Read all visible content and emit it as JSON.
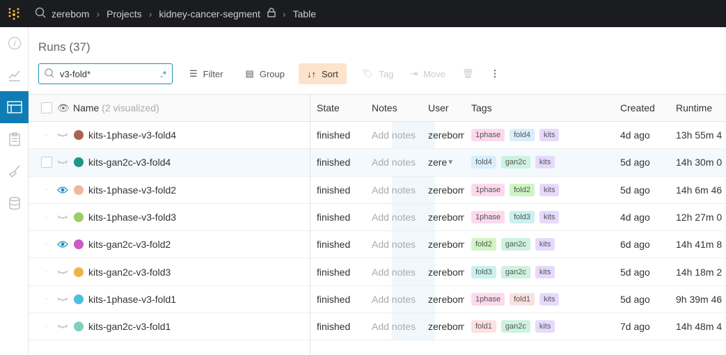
{
  "breadcrumb": [
    "zerebom",
    "Projects",
    "kidney-cancer-segment",
    "Table"
  ],
  "title": "Runs (37)",
  "search": {
    "value": "v3-fold*",
    "regex_label": ".*"
  },
  "toolbar": {
    "filter": "Filter",
    "group": "Group",
    "sort": "Sort",
    "tag": "Tag",
    "move": "Move"
  },
  "columns": {
    "name": "Name",
    "visualized": "(2 visualized)",
    "state": "State",
    "notes": "Notes",
    "user": "User",
    "tags": "Tags",
    "created": "Created",
    "runtime": "Runtime"
  },
  "tag_colors": {
    "1phase": "#fcd9ec",
    "fold4": "#d8eefc",
    "kits": "#e6dafc",
    "gan2c": "#cdf2df",
    "fold2": "#cff5c4",
    "fold3": "#c9f1ef",
    "fold1": "#fde0e0"
  },
  "rows": [
    {
      "name": "kits-1phase-v3-fold4",
      "color": "#a86552",
      "visible": false,
      "state": "finished",
      "notes": "Add notes",
      "user": "zerebom",
      "tags": [
        "1phase",
        "fold4",
        "kits"
      ],
      "created": "4d ago",
      "runtime": "13h 55m 4"
    },
    {
      "name": "kits-gan2c-v3-fold4",
      "color": "#1e9686",
      "visible": false,
      "state": "finished",
      "notes": "Add notes",
      "user": "zere",
      "tags": [
        "fold4",
        "gan2c",
        "kits"
      ],
      "created": "5d ago",
      "runtime": "14h 30m 0"
    },
    {
      "name": "kits-1phase-v3-fold2",
      "color": "#f0b79b",
      "visible": true,
      "state": "finished",
      "notes": "Add notes",
      "user": "zerebom",
      "tags": [
        "1phase",
        "fold2",
        "kits"
      ],
      "created": "5d ago",
      "runtime": "14h 6m 46"
    },
    {
      "name": "kits-1phase-v3-fold3",
      "color": "#9ccc6a",
      "visible": false,
      "state": "finished",
      "notes": "Add notes",
      "user": "zerebom",
      "tags": [
        "1phase",
        "fold3",
        "kits"
      ],
      "created": "4d ago",
      "runtime": "12h 27m 0"
    },
    {
      "name": "kits-gan2c-v3-fold2",
      "color": "#c85cc2",
      "visible": true,
      "state": "finished",
      "notes": "Add notes",
      "user": "zerebom",
      "tags": [
        "fold2",
        "gan2c",
        "kits"
      ],
      "created": "6d ago",
      "runtime": "14h 41m 8"
    },
    {
      "name": "kits-gan2c-v3-fold3",
      "color": "#f2b14c",
      "visible": false,
      "state": "finished",
      "notes": "Add notes",
      "user": "zerebom",
      "tags": [
        "fold3",
        "gan2c",
        "kits"
      ],
      "created": "5d ago",
      "runtime": "14h 18m 2"
    },
    {
      "name": "kits-1phase-v3-fold1",
      "color": "#4cc0de",
      "visible": false,
      "state": "finished",
      "notes": "Add notes",
      "user": "zerebom",
      "tags": [
        "1phase",
        "fold1",
        "kits"
      ],
      "created": "5d ago",
      "runtime": "9h 39m 46"
    },
    {
      "name": "kits-gan2c-v3-fold1",
      "color": "#7fcfbf",
      "visible": false,
      "state": "finished",
      "notes": "Add notes",
      "user": "zerebom",
      "tags": [
        "fold1",
        "gan2c",
        "kits"
      ],
      "created": "7d ago",
      "runtime": "14h 48m 4"
    }
  ]
}
